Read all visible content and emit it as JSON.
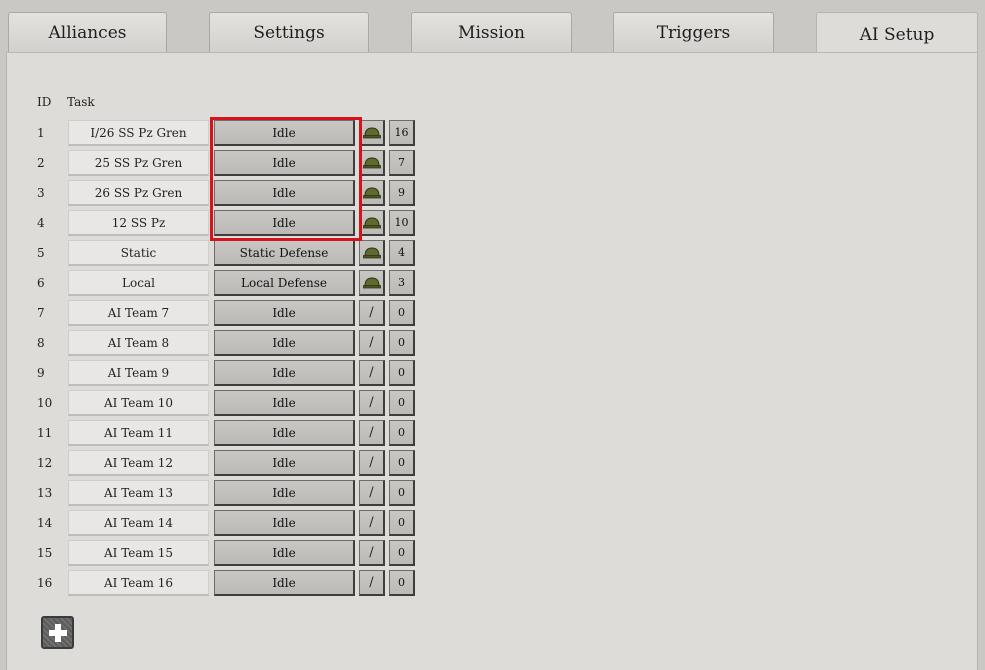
{
  "tabs": [
    {
      "label": "Alliances"
    },
    {
      "label": "Settings"
    },
    {
      "label": "Mission"
    },
    {
      "label": "Triggers"
    },
    {
      "label": "AI Setup"
    }
  ],
  "active_tab": "AI Setup",
  "table": {
    "header_id": "ID",
    "header_task": "Task",
    "rows": [
      {
        "id": "1",
        "name": "I/26 SS Pz Gren",
        "task": "Idle",
        "stance": "helmet",
        "count": "16"
      },
      {
        "id": "2",
        "name": "25 SS Pz Gren",
        "task": "Idle",
        "stance": "helmet",
        "count": "7"
      },
      {
        "id": "3",
        "name": "26 SS Pz Gren",
        "task": "Idle",
        "stance": "helmet",
        "count": "9"
      },
      {
        "id": "4",
        "name": "12 SS Pz",
        "task": "Idle",
        "stance": "helmet",
        "count": "10"
      },
      {
        "id": "5",
        "name": "Static",
        "task": "Static Defense",
        "stance": "helmet",
        "count": "4"
      },
      {
        "id": "6",
        "name": "Local",
        "task": "Local Defense",
        "stance": "helmet",
        "count": "3"
      },
      {
        "id": "7",
        "name": "AI Team 7",
        "task": "Idle",
        "stance": "/",
        "count": "0"
      },
      {
        "id": "8",
        "name": "AI Team 8",
        "task": "Idle",
        "stance": "/",
        "count": "0"
      },
      {
        "id": "9",
        "name": "AI Team 9",
        "task": "Idle",
        "stance": "/",
        "count": "0"
      },
      {
        "id": "10",
        "name": "AI Team 10",
        "task": "Idle",
        "stance": "/",
        "count": "0"
      },
      {
        "id": "11",
        "name": "AI Team 11",
        "task": "Idle",
        "stance": "/",
        "count": "0"
      },
      {
        "id": "12",
        "name": "AI Team 12",
        "task": "Idle",
        "stance": "/",
        "count": "0"
      },
      {
        "id": "13",
        "name": "AI Team 13",
        "task": "Idle",
        "stance": "/",
        "count": "0"
      },
      {
        "id": "14",
        "name": "AI Team 14",
        "task": "Idle",
        "stance": "/",
        "count": "0"
      },
      {
        "id": "15",
        "name": "AI Team 15",
        "task": "Idle",
        "stance": "/",
        "count": "0"
      },
      {
        "id": "16",
        "name": "AI Team 16",
        "task": "Idle",
        "stance": "/",
        "count": "0"
      }
    ]
  },
  "add_button_icon": "plus-icon",
  "colors": {
    "highlight": "#d6121a",
    "helmet": "#5f6a2e"
  }
}
